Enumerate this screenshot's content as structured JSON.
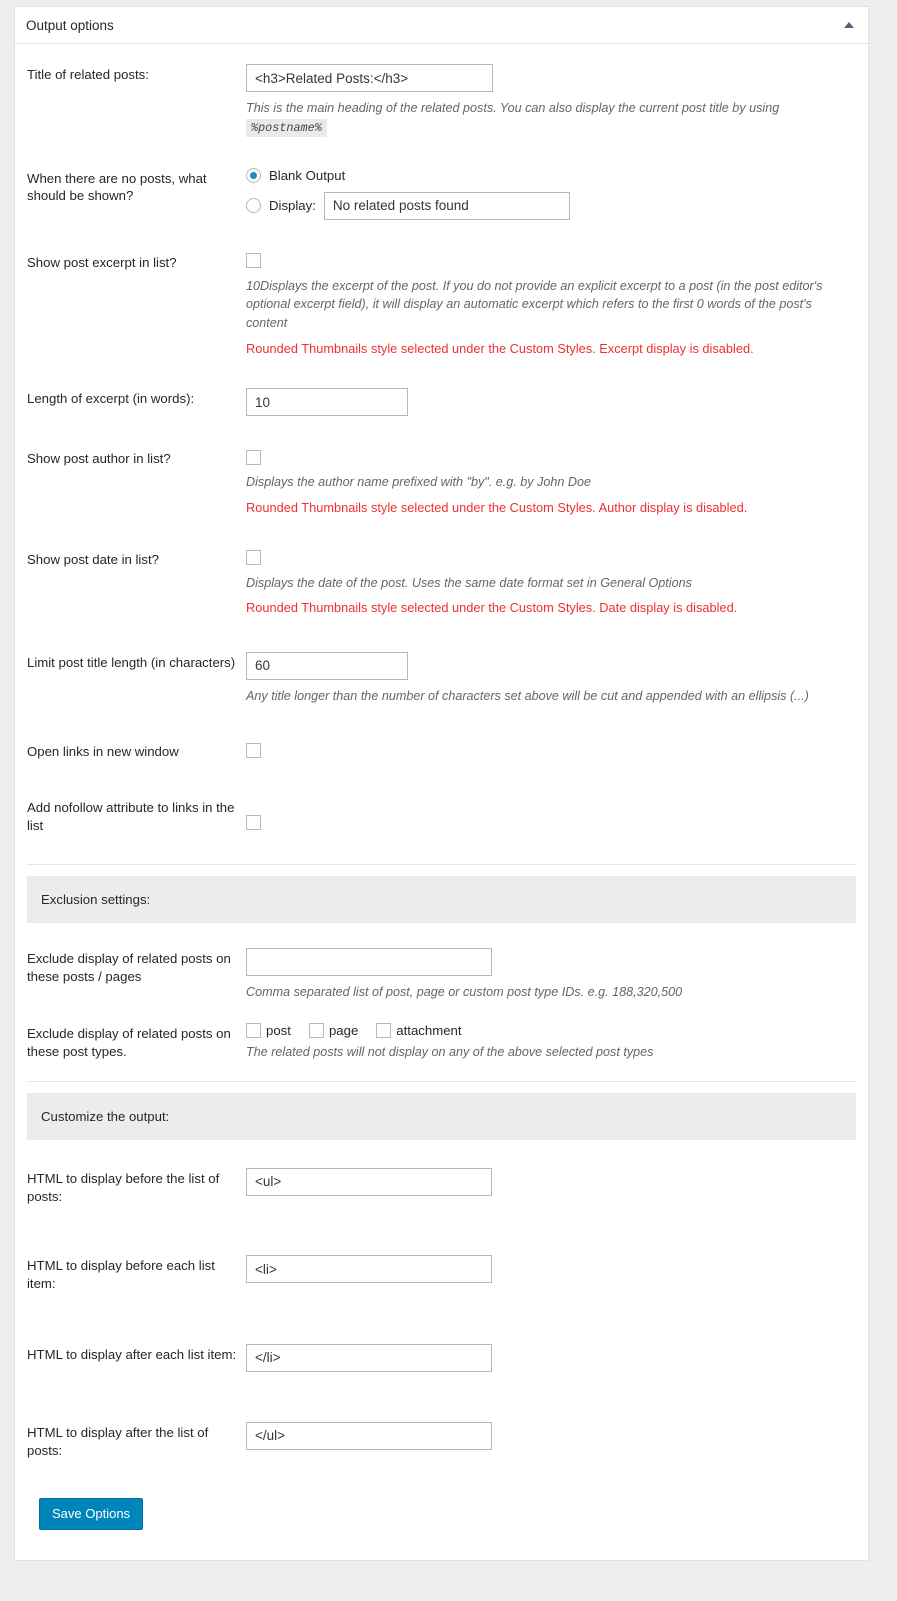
{
  "panel": {
    "title": "Output options",
    "toggle_icon": "caret-up-icon"
  },
  "fields": {
    "title_of_related_posts": {
      "label": "Title of related posts:",
      "value": "<h3>Related Posts:</h3>",
      "desc_before": "This is the main heading of the related posts. You can also display the current post title by using",
      "desc_code": "%postname%"
    },
    "no_posts": {
      "label": "When there are no posts, what should be shown?",
      "option_blank": "Blank Output",
      "option_display": "Display:",
      "display_value": "No related posts found",
      "selected": "blank"
    },
    "show_excerpt": {
      "label": "Show post excerpt in list?",
      "checked": false,
      "desc": "10Displays the excerpt of the post. If you do not provide an explicit excerpt to a post (in the post editor's optional excerpt field), it will display an automatic excerpt which refers to the first 0 words of the post's content",
      "warning": "Rounded Thumbnails style selected under the Custom Styles. Excerpt display is disabled."
    },
    "excerpt_length": {
      "label": "Length of excerpt (in words):",
      "value": "10"
    },
    "show_author": {
      "label": "Show post author in list?",
      "checked": false,
      "desc": "Displays the author name prefixed with \"by\". e.g. by John Doe",
      "warning": "Rounded Thumbnails style selected under the Custom Styles. Author display is disabled."
    },
    "show_date": {
      "label": "Show post date in list?",
      "checked": false,
      "desc": "Displays the date of the post. Uses the same date format set in General Options",
      "warning": "Rounded Thumbnails style selected under the Custom Styles. Date display is disabled."
    },
    "title_length": {
      "label": "Limit post title length (in characters)",
      "value": "60",
      "desc": "Any title longer than the number of characters set above will be cut and appended with an ellipsis (...)"
    },
    "open_new_window": {
      "label": "Open links in new window",
      "checked": false
    },
    "nofollow": {
      "label": "Add nofollow attribute to links in the list",
      "checked": false
    }
  },
  "exclusion": {
    "heading": "Exclusion settings:",
    "exclude_posts": {
      "label": "Exclude display of related posts on these posts / pages",
      "value": "",
      "desc": "Comma separated list of post, page or custom post type IDs. e.g. 188,320,500"
    },
    "exclude_post_types": {
      "label": "Exclude display of related posts on these post types.",
      "options": [
        {
          "label": "post",
          "checked": false
        },
        {
          "label": "page",
          "checked": false
        },
        {
          "label": "attachment",
          "checked": false
        }
      ],
      "desc": "The related posts will not display on any of the above selected post types"
    }
  },
  "customize": {
    "heading": "Customize the output:",
    "before_list": {
      "label": "HTML to display before the list of posts:",
      "value": "<ul>"
    },
    "before_item": {
      "label": "HTML to display before each list item:",
      "value": "<li>"
    },
    "after_item": {
      "label": "HTML to display after each list item:",
      "value": "</li>"
    },
    "after_list": {
      "label": "HTML to display after the list of posts:",
      "value": "</ul>"
    }
  },
  "actions": {
    "save_label": "Save Options"
  },
  "colors": {
    "accent": "#0085ba",
    "radio_fill": "#1e8cbe",
    "warning": "#f03030",
    "section_bar": "#ececec",
    "page_bg": "#eeeeee"
  }
}
